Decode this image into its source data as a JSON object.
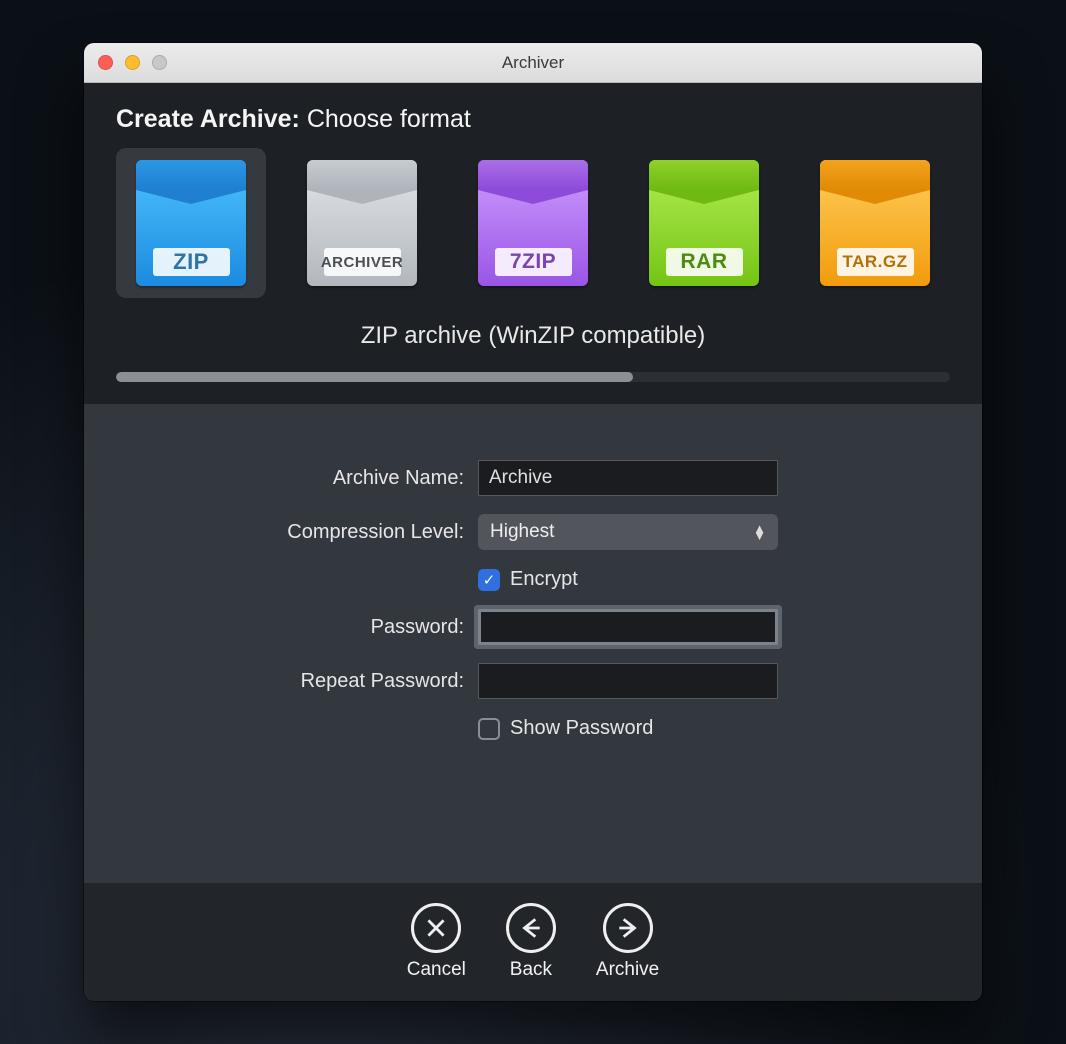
{
  "window": {
    "title": "Archiver"
  },
  "header": {
    "title_strong": "Create Archive:",
    "title_rest": "Choose format"
  },
  "formats": [
    {
      "label": "ZIP",
      "selected": true
    },
    {
      "label": "ARCHIVER",
      "selected": false
    },
    {
      "label": "7ZIP",
      "selected": false
    },
    {
      "label": "RAR",
      "selected": false
    },
    {
      "label": "TAR.GZ",
      "selected": false
    }
  ],
  "format_description": "ZIP archive (WinZIP compatible)",
  "progress_percent": 62,
  "form": {
    "archive_name_label": "Archive Name:",
    "archive_name_value": "Archive",
    "compression_label": "Compression Level:",
    "compression_value": "Highest",
    "encrypt_label": "Encrypt",
    "encrypt_checked": true,
    "password_label": "Password:",
    "password_value": "",
    "repeat_password_label": "Repeat Password:",
    "repeat_password_value": "",
    "show_password_label": "Show Password",
    "show_password_checked": false
  },
  "footer": {
    "cancel": "Cancel",
    "back": "Back",
    "archive": "Archive"
  }
}
